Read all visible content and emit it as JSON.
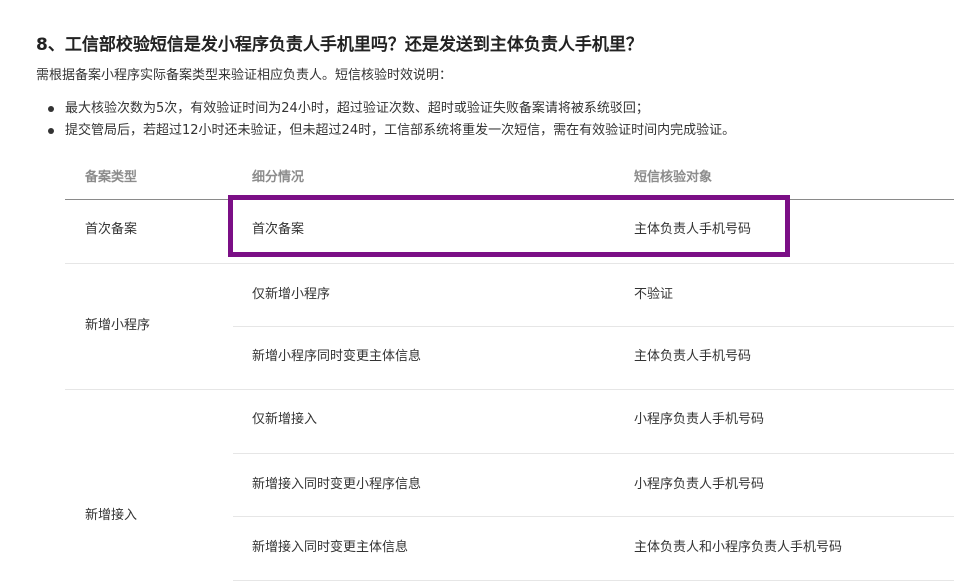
{
  "heading": "8、工信部校验短信是发小程序负责人手机里吗？还是发送到主体负责人手机里？",
  "intro": "需根据备案小程序实际备案类型来验证相应负责人。短信核验时效说明：",
  "bullets": [
    "最大核验次数为5次，有效验证时间为24小时，超过验证次数、超时或验证失败备案请将被系统驳回；",
    "提交管局后，若超过12小时还未验证，但未超过24时，工信部系统将重发一次短信，需在有效验证时间内完成验证。"
  ],
  "table": {
    "headers": [
      "备案类型",
      "细分情况",
      "短信核验对象"
    ],
    "groups": [
      {
        "type": "首次备案",
        "rows": [
          {
            "detail": "首次备案",
            "target": "主体负责人手机号码"
          }
        ]
      },
      {
        "type": "新增小程序",
        "rows": [
          {
            "detail": "仅新增小程序",
            "target": "不验证"
          },
          {
            "detail": "新增小程序同时变更主体信息",
            "target": "主体负责人手机号码"
          }
        ]
      },
      {
        "type": "新增接入",
        "rows": [
          {
            "detail": "仅新增接入",
            "target": "小程序负责人手机号码"
          },
          {
            "detail": "新增接入同时变更小程序信息",
            "target": "小程序负责人手机号码"
          },
          {
            "detail": "新增接入同时变更主体信息",
            "target": "主体负责人和小程序负责人手机号码"
          }
        ]
      }
    ]
  },
  "highlight_color": "#7b0f86"
}
